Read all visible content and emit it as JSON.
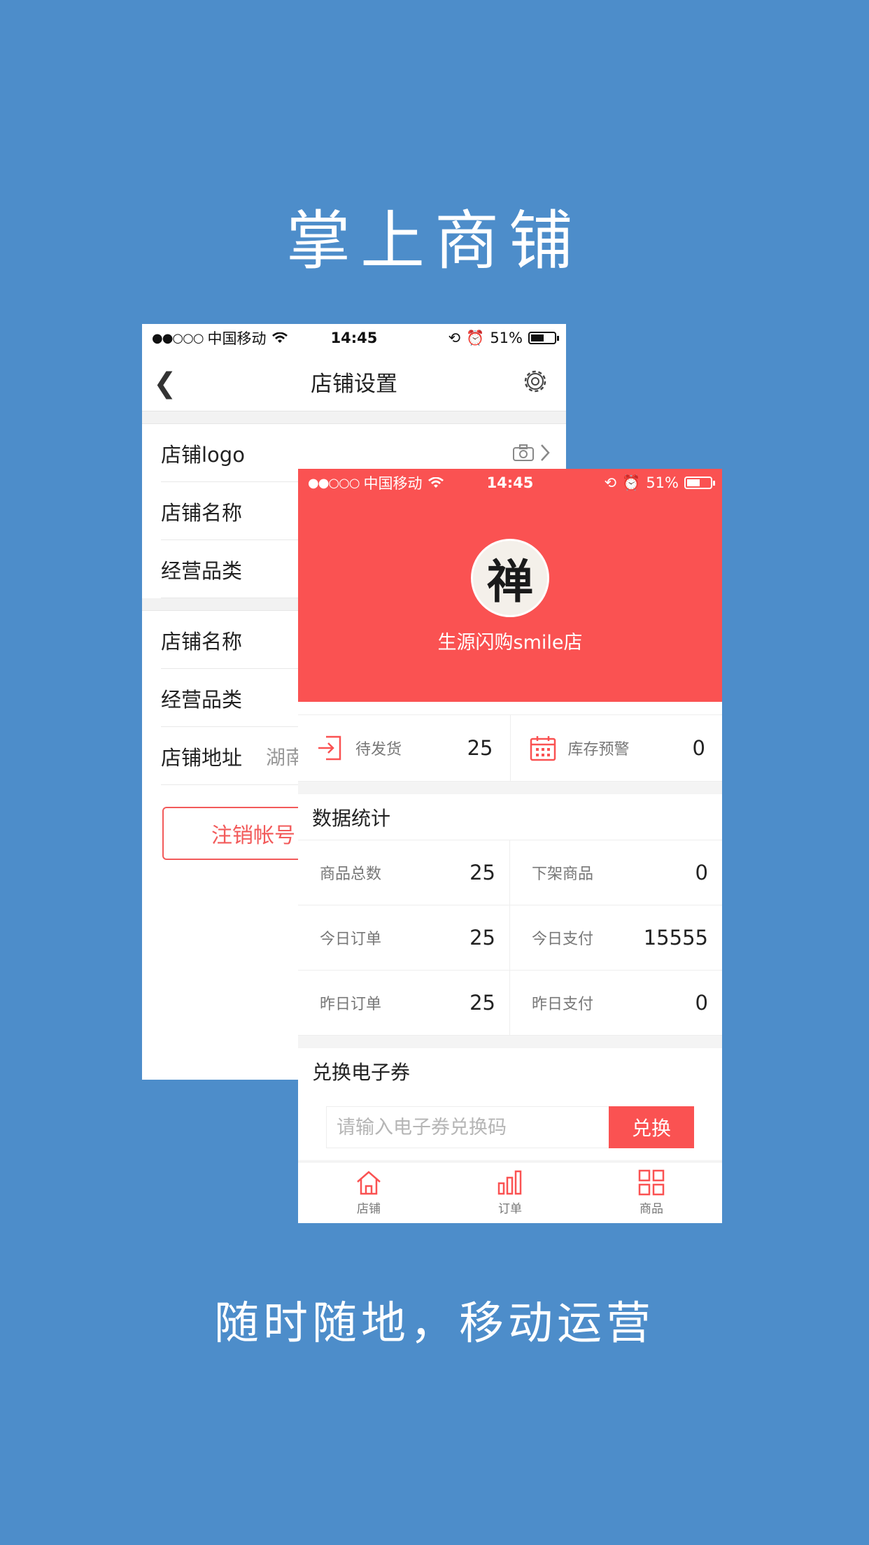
{
  "headline_top": "掌上商铺",
  "headline_bottom": "随时随地，移动运营",
  "colors": {
    "background": "#4d8dca",
    "accent": "#fa5252"
  },
  "status_bar": {
    "signal": "●●○○○",
    "carrier": "中国移动",
    "time": "14:45",
    "battery": "51%",
    "battery_level": 0.51
  },
  "settings_screen": {
    "title": "店铺设置",
    "rows_group1": [
      "店铺logo",
      "店铺名称",
      "经营品类"
    ],
    "rows_group2": [
      "店铺名称",
      "经营品类",
      "店铺地址"
    ],
    "address_value": "湖南",
    "logout_label": "注销帐号",
    "icons": [
      "back-arrow-icon",
      "gear-icon",
      "camera-icon",
      "chevron-right-icon"
    ]
  },
  "dashboard": {
    "shop_name": "生源闪购smile店",
    "avatar_glyph": "禅",
    "quick": [
      {
        "label": "待发货",
        "value": "25",
        "icon": "import-icon"
      },
      {
        "label": "库存预警",
        "value": "0",
        "icon": "calendar-icon"
      }
    ],
    "stats_title": "数据统计",
    "stats": [
      {
        "label": "商品总数",
        "value": "25"
      },
      {
        "label": "下架商品",
        "value": "0"
      },
      {
        "label": "今日订单",
        "value": "25"
      },
      {
        "label": "今日支付",
        "value": "15555"
      },
      {
        "label": "昨日订单",
        "value": "25"
      },
      {
        "label": "昨日支付",
        "value": "0"
      }
    ],
    "redeem_title": "兑换电子券",
    "redeem_placeholder": "请输入电子券兑换码",
    "redeem_button": "兑换",
    "tabs": [
      {
        "label": "店铺",
        "icon": "home-icon"
      },
      {
        "label": "订单",
        "icon": "bar-chart-icon"
      },
      {
        "label": "商品",
        "icon": "grid-icon"
      }
    ]
  }
}
